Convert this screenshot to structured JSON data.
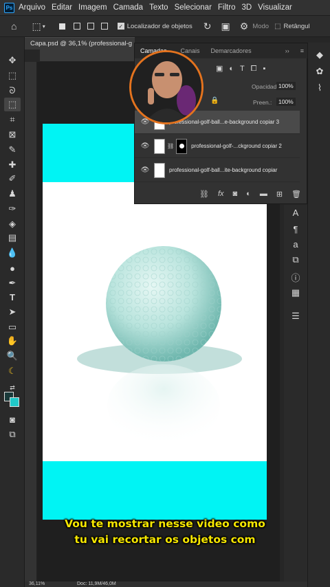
{
  "app": {
    "logo": "Ps"
  },
  "menu": [
    "Arquivo",
    "Editar",
    "Imagem",
    "Camada",
    "Texto",
    "Selecionar",
    "Filtro",
    "3D",
    "Visualizar"
  ],
  "options": {
    "object_finder_label": "Localizador de objetos",
    "mode_label": "Modo",
    "shape_label": "Retângul"
  },
  "document": {
    "tab_title": "Capa.psd @ 36,1% (professional-g",
    "zoom": "36,11%",
    "doc_size": "Doc: 11,9M/46,0M"
  },
  "layers_panel": {
    "tabs": [
      "Camadas",
      "Canais",
      "Demarcadores"
    ],
    "opacity_label": "Opacidade:",
    "opacity_value": "100%",
    "fill_label": "Preen.:",
    "fill_value": "100%",
    "layers": [
      {
        "name": "professional-golf-ball...e-background copiar 3"
      },
      {
        "name": "professional-golf-...ckground copiar 2"
      },
      {
        "name": "professional-golf-ball...ite-background copiar"
      }
    ]
  },
  "subtitle": {
    "line1": "Vou te mostrar nesse video como",
    "line2": "tu vai recortar os objetos com"
  },
  "colors": {
    "accent_cyan": "#00f4f4",
    "subtitle_yellow": "#f5e600",
    "webcam_ring": "#e4731e"
  }
}
